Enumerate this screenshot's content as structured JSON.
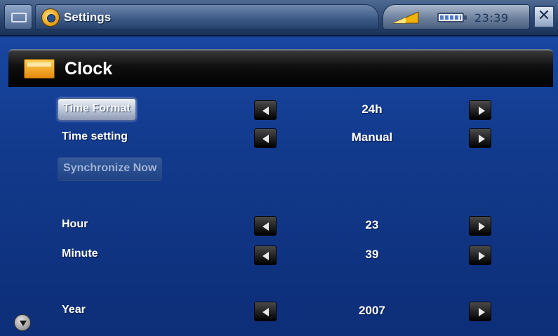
{
  "window": {
    "title": "Settings",
    "clock": "23:39",
    "icons": {
      "home": "home-tab-icon",
      "settings": "settings-icon",
      "signal": "signal-icon",
      "battery": "battery-icon",
      "close": "close-icon"
    }
  },
  "section": {
    "title": "Clock",
    "icon": "clock-app-icon"
  },
  "rows": {
    "time_format": {
      "label": "Time Format",
      "value": "24h"
    },
    "time_setting": {
      "label": "Time setting",
      "value": "Manual"
    },
    "synchronize": {
      "label": "Synchronize Now"
    },
    "hour": {
      "label": "Hour",
      "value": "23"
    },
    "minute": {
      "label": "Minute",
      "value": "39"
    },
    "year": {
      "label": "Year",
      "value": "2007"
    }
  },
  "colors": {
    "background": "#123a8c",
    "header": "#000000",
    "accent": "#e39b12"
  }
}
